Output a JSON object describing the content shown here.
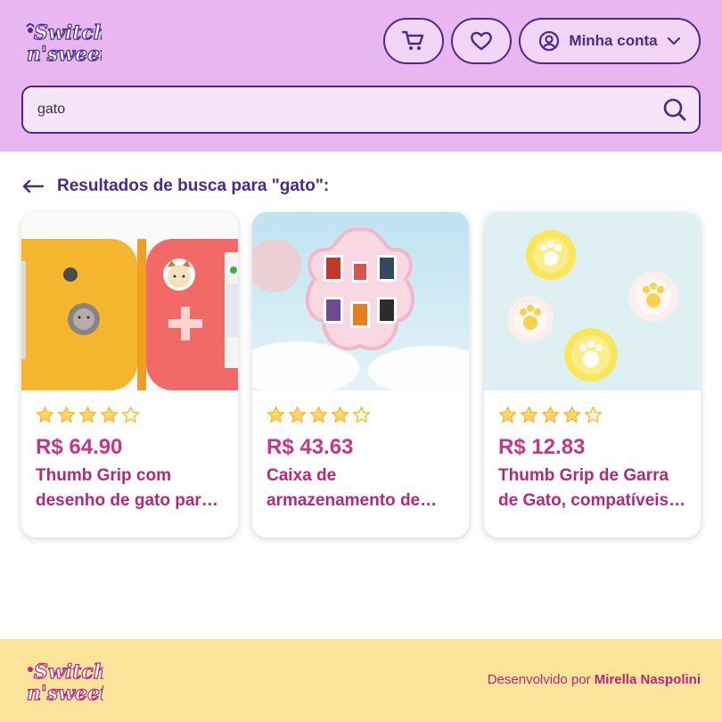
{
  "brand": {
    "logo_text_line1": "Switch",
    "logo_text_line2": "n'sweet",
    "primary": "#4b2a8c",
    "accent": "#c2378a",
    "header_bg": "#e8b6f0",
    "footer_bg": "#fde49a"
  },
  "header": {
    "cart_icon": "cart-icon",
    "favorites_icon": "heart-icon",
    "account": {
      "icon": "user-circle-icon",
      "label": "Minha conta",
      "chevron": "chevron-down-icon"
    }
  },
  "search": {
    "value": "gato",
    "placeholder": "",
    "icon": "search-icon"
  },
  "results": {
    "title": "Resultados de busca para \"gato\":"
  },
  "products": [
    {
      "rating": 4,
      "price": "R$ 64.90",
      "title": "Thumb Grip com desenho de gato para Nintendo Switch"
    },
    {
      "rating": 4,
      "price": "R$ 43.63",
      "title": "Caixa de armazenamento de cartões de jogo"
    },
    {
      "rating": 4,
      "price": "R$ 12.83",
      "title": "Thumb Grip de Garra de Gato, compatíveis com Switch"
    }
  ],
  "footer": {
    "credit_prefix": "Desenvolvido por",
    "credit_author": "Mirella Naspolini"
  }
}
